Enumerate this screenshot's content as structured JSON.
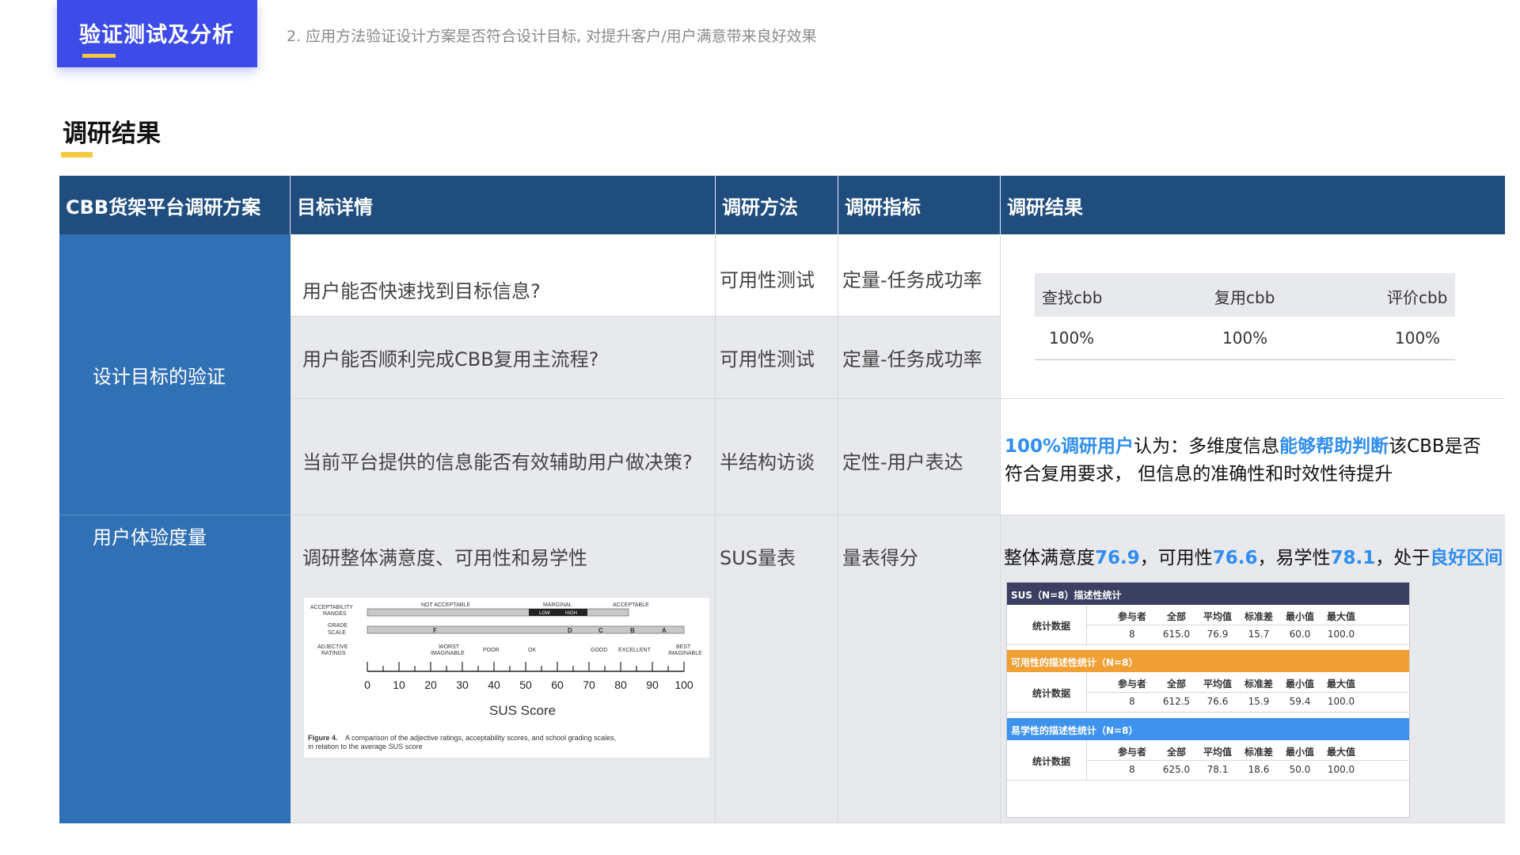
{
  "header": {
    "section_tag": "验证测试及分析",
    "subtitle": "2. 应用方法验证设计方案是否符合设计目标, 对提升客户/用户满意带来良好效果"
  },
  "section_title": "调研结果",
  "table": {
    "headers": [
      "CBB货架平台调研方案",
      "目标详情",
      "调研方法",
      "调研指标",
      "调研结果"
    ],
    "categories": [
      "设计目标的验证",
      "用户体验度量"
    ],
    "rows": [
      {
        "goal": "用户能否快速找到目标信息?",
        "method": "可用性测试",
        "metric": "定量-任务成功率"
      },
      {
        "goal": "用户能否顺利完成CBB复用主流程?",
        "method": "可用性测试",
        "metric": "定量-任务成功率"
      },
      {
        "goal": "当前平台提供的信息能否有效辅助用户做决策?",
        "method": "半结构访谈",
        "metric": "定性-用户表达"
      },
      {
        "goal": "调研整体满意度、可用性和易学性",
        "method": "SUS量表",
        "metric": "量表得分"
      }
    ],
    "success_table": {
      "headers": [
        "查找cbb",
        "复用cbb",
        "评价cbb"
      ],
      "values": [
        "100%",
        "100%",
        "100%"
      ]
    },
    "interview_result": {
      "p1": "100%调研用户",
      "p2": "认为：多维度信息",
      "p3": "能够帮助判断",
      "p4": "该CBB是否",
      "line2": "符合复用要求， 但信息的准确性和时效性待提升"
    },
    "sus_result": {
      "a": "整体满意度",
      "a_val": "76.9",
      "b": "，可用性",
      "b_val": "76.6",
      "c": "，易学性",
      "c_val": "78.1",
      "d": "，处于",
      "d_val": "良好区间"
    }
  },
  "sus_figure": {
    "range_labels": [
      "ACCEPTABILITY",
      "RANGES",
      "NOT ACCEPTABLE",
      "MARGINAL",
      "LOW",
      "HIGH",
      "ACCEPTABLE"
    ],
    "grade_labels": [
      "GRADE",
      "SCALE",
      "F",
      "D",
      "C",
      "B",
      "A"
    ],
    "adjective_labels": [
      "ADJECTIVE",
      "RATINGS",
      "WORST",
      "IMAGINABLE",
      "POOR",
      "OK",
      "GOOD",
      "EXCELLENT",
      "BEST",
      "IMAGINABLE"
    ],
    "ticks": [
      "0",
      "10",
      "20",
      "30",
      "40",
      "50",
      "60",
      "70",
      "80",
      "90",
      "100"
    ],
    "axis_title": "SUS Score",
    "caption_bold": "Figure 4.",
    "caption_1": "A comparison of the adjective ratings, acceptability scores, and school grading scales,",
    "caption_2": "in relation to the average SUS score"
  },
  "stats_panels": [
    {
      "title": "SUS（N=8）描述性统计",
      "color": "#3b4062",
      "row_label": "统计数据",
      "cols": [
        "参与者",
        "全部",
        "平均值",
        "标准差",
        "最小值",
        "最大值"
      ],
      "values": [
        "8",
        "615.0",
        "76.9",
        "15.7",
        "60.0",
        "100.0"
      ]
    },
    {
      "title": "可用性的描述性统计（N=8）",
      "color": "#f0a035",
      "row_label": "统计数据",
      "cols": [
        "参与者",
        "全部",
        "平均值",
        "标准差",
        "最小值",
        "最大值"
      ],
      "values": [
        "8",
        "612.5",
        "76.6",
        "15.9",
        "59.4",
        "100.0"
      ]
    },
    {
      "title": "易学性的描述性统计（N=8）",
      "color": "#3d93ee",
      "row_label": "统计数据",
      "cols": [
        "参与者",
        "全部",
        "平均值",
        "标准差",
        "最小值",
        "最大值"
      ],
      "values": [
        "8",
        "625.0",
        "78.1",
        "18.6",
        "50.0",
        "100.0"
      ]
    }
  ],
  "colors": {
    "accent_blue": "#3d4ce8",
    "header_navy": "#1f4d7e",
    "category_blue": "#3070b5",
    "highlight_blue": "#2f8ef0",
    "underline_yellow": "#f5c842"
  }
}
